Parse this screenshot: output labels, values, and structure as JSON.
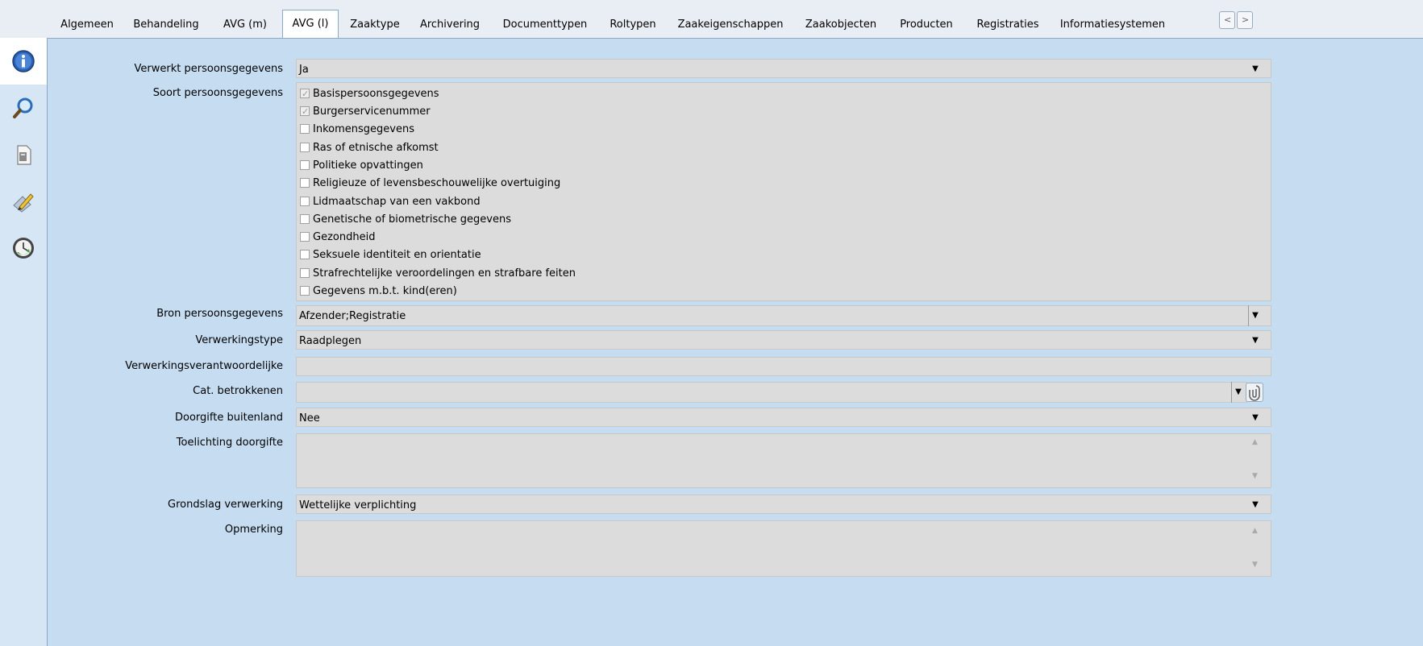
{
  "tabs": [
    {
      "label": "Algemeen"
    },
    {
      "label": "Behandeling"
    },
    {
      "label": "AVG (m)"
    },
    {
      "label": "AVG (l)"
    },
    {
      "label": "Zaaktype"
    },
    {
      "label": "Archivering"
    },
    {
      "label": "Documenttypen"
    },
    {
      "label": "Roltypen"
    },
    {
      "label": "Zaakeigenschappen"
    },
    {
      "label": "Zaakobjecten"
    },
    {
      "label": "Producten"
    },
    {
      "label": "Registraties"
    },
    {
      "label": "Informatiesystemen"
    }
  ],
  "active_tab": "AVG (l)",
  "sidebar": {
    "icons": [
      "info-icon",
      "search-icon",
      "document-icon",
      "edit-pencil-icon",
      "clock-refresh-icon"
    ]
  },
  "form": {
    "verwerkt": {
      "label": "Verwerkt persoonsgegevens",
      "value": "Ja"
    },
    "soort": {
      "label": "Soort persoonsgegevens",
      "items": [
        {
          "label": "Basispersoonsgegevens",
          "checked": true
        },
        {
          "label": "Burgerservicenummer",
          "checked": true
        },
        {
          "label": "Inkomensgegevens",
          "checked": false
        },
        {
          "label": "Ras of etnische afkomst",
          "checked": false
        },
        {
          "label": "Politieke opvattingen",
          "checked": false
        },
        {
          "label": "Religieuze of levensbeschouwelijke overtuiging",
          "checked": false
        },
        {
          "label": "Lidmaatschap van een vakbond",
          "checked": false
        },
        {
          "label": "Genetische of biometrische gegevens",
          "checked": false
        },
        {
          "label": "Gezondheid",
          "checked": false
        },
        {
          "label": "Seksuele identiteit en orientatie",
          "checked": false
        },
        {
          "label": "Strafrechtelijke veroordelingen en strafbare feiten",
          "checked": false
        },
        {
          "label": "Gegevens m.b.t. kind(eren)",
          "checked": false
        }
      ]
    },
    "bron": {
      "label": "Bron persoonsgegevens",
      "value": "Afzender;Registratie"
    },
    "verwerkingstype": {
      "label": "Verwerkingstype",
      "value": "Raadplegen"
    },
    "verantwoordelijke": {
      "label": "Verwerkingsverantwoordelijke",
      "value": ""
    },
    "cat": {
      "label": "Cat. betrokkenen",
      "value": ""
    },
    "doorgifte": {
      "label": "Doorgifte buitenland",
      "value": "Nee"
    },
    "toelichting": {
      "label": "Toelichting doorgifte",
      "value": ""
    },
    "grondslag": {
      "label": "Grondslag verwerking",
      "value": "Wettelijke verplichting"
    },
    "opmerking": {
      "label": "Opmerking",
      "value": ""
    }
  }
}
